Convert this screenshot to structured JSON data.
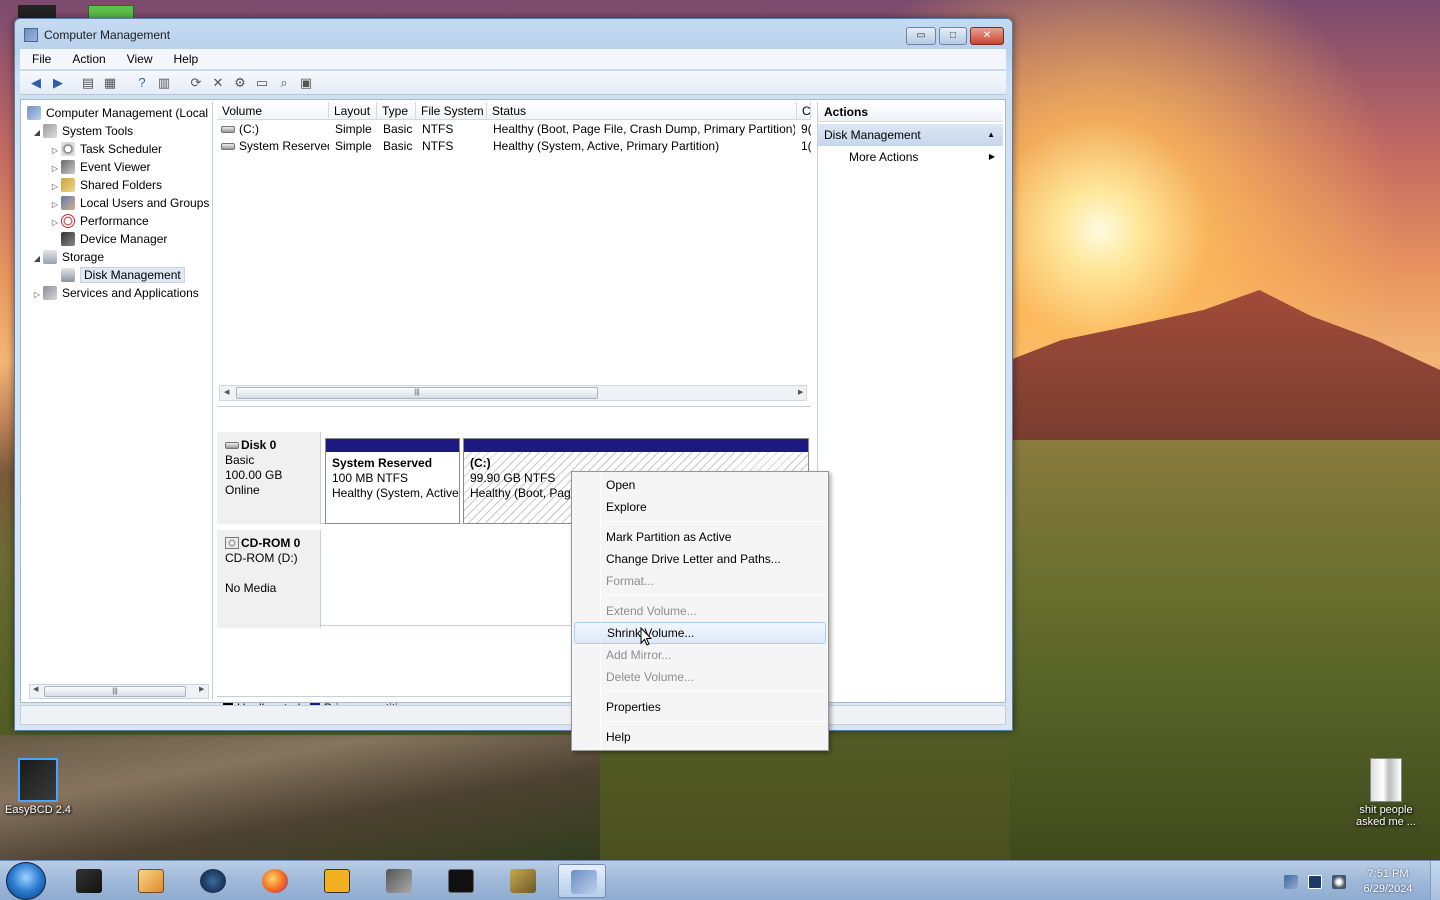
{
  "window": {
    "title": "Computer Management",
    "min_glyph": "▭",
    "max_glyph": "□",
    "close_glyph": "✕"
  },
  "menu": [
    "File",
    "Action",
    "View",
    "Help"
  ],
  "tree": {
    "root": "Computer Management (Local",
    "items": [
      {
        "label": "System Tools",
        "icon": "tools-icon"
      },
      {
        "label": "Task Scheduler",
        "icon": "clock-icon"
      },
      {
        "label": "Event Viewer",
        "icon": "event-viewer-icon"
      },
      {
        "label": "Shared Folders",
        "icon": "shared-folder-icon"
      },
      {
        "label": "Local Users and Groups",
        "icon": "users-icon"
      },
      {
        "label": "Performance",
        "icon": "performance-icon"
      },
      {
        "label": "Device Manager",
        "icon": "device-manager-icon"
      },
      {
        "label": "Storage",
        "icon": "storage-icon"
      },
      {
        "label": "Disk Management",
        "icon": "disk-icon"
      },
      {
        "label": "Services and Applications",
        "icon": "services-icon"
      }
    ]
  },
  "volume_table": {
    "headers": [
      "Volume",
      "Layout",
      "Type",
      "File System",
      "Status",
      "C"
    ],
    "rows": [
      {
        "volume": "(C:)",
        "layout": "Simple",
        "type": "Basic",
        "fs": "NTFS",
        "status": "Healthy (Boot, Page File, Crash Dump, Primary Partition)",
        "c": "9("
      },
      {
        "volume": "System Reserved",
        "layout": "Simple",
        "type": "Basic",
        "fs": "NTFS",
        "status": "Healthy (System, Active, Primary Partition)",
        "c": "1("
      }
    ]
  },
  "disks": [
    {
      "name": "Disk 0",
      "kind": "Basic",
      "size": "100.00 GB",
      "state": "Online"
    },
    {
      "name": "CD-ROM 0",
      "kind": "CD-ROM (D:)",
      "size": "",
      "state": "No Media"
    }
  ],
  "partitions": [
    {
      "title": "System Reserved",
      "size": "100 MB NTFS",
      "status": "Healthy (System, Active"
    },
    {
      "title": "(C:)",
      "size": "99.90 GB NTFS",
      "status": "Healthy (Boot, Page"
    }
  ],
  "legend": {
    "unallocated": "Unallocated",
    "primary": "Primary partition",
    "unallocated_color": "#000000",
    "primary_color": "#1a1a80"
  },
  "actions": {
    "header": "Actions",
    "section": "Disk Management",
    "more": "More Actions"
  },
  "context_menu": [
    {
      "label": "Open",
      "enabled": true
    },
    {
      "label": "Explore",
      "enabled": true
    },
    {
      "label": "Mark Partition as Active",
      "enabled": true
    },
    {
      "label": "Change Drive Letter and Paths...",
      "enabled": true
    },
    {
      "label": "Format...",
      "enabled": false
    },
    {
      "label": "Extend Volume...",
      "enabled": false
    },
    {
      "label": "Shrink Volume...",
      "enabled": true,
      "highlighted": true
    },
    {
      "label": "Add Mirror...",
      "enabled": false
    },
    {
      "label": "Delete Volume...",
      "enabled": false
    },
    {
      "label": "Properties",
      "enabled": true
    },
    {
      "label": "Help",
      "enabled": true
    }
  ],
  "desktop_icons": [
    {
      "label": "EasyBCD 2.4"
    },
    {
      "label": "shit people asked me ..."
    }
  ],
  "clock": {
    "time": "7:51 PM",
    "date": "6/29/2024"
  }
}
